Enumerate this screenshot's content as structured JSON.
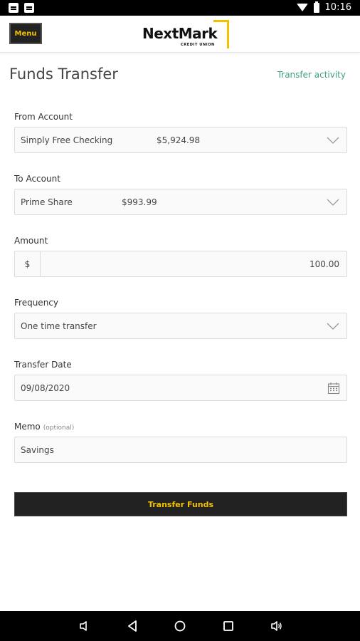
{
  "status_bar": {
    "time": "10:16"
  },
  "header": {
    "menu_label": "Menu",
    "logo_name": "NextMark",
    "logo_sub": "CREDIT UNION",
    "brand_color": "#f2c200"
  },
  "page": {
    "title": "Funds Transfer",
    "activity_link": "Transfer activity"
  },
  "form": {
    "from": {
      "label": "From Account",
      "account": "Simply Free Checking",
      "balance": "$5,924.98"
    },
    "to": {
      "label": "To Account",
      "account": "Prime Share",
      "balance": "$993.99"
    },
    "amount": {
      "label": "Amount",
      "prefix": "$",
      "value": "100.00"
    },
    "frequency": {
      "label": "Frequency",
      "value": "One time transfer"
    },
    "date": {
      "label": "Transfer Date",
      "value": "09/08/2020"
    },
    "memo": {
      "label": "Memo",
      "optional": "(optional)",
      "value": "Savings"
    },
    "submit_label": "Transfer Funds"
  },
  "icons": {
    "wifi": "wifi-icon",
    "battery": "battery-icon",
    "chevron": "chevron-down-icon",
    "calendar": "calendar-icon",
    "back": "back-icon",
    "home": "home-icon",
    "recents": "recents-icon"
  }
}
